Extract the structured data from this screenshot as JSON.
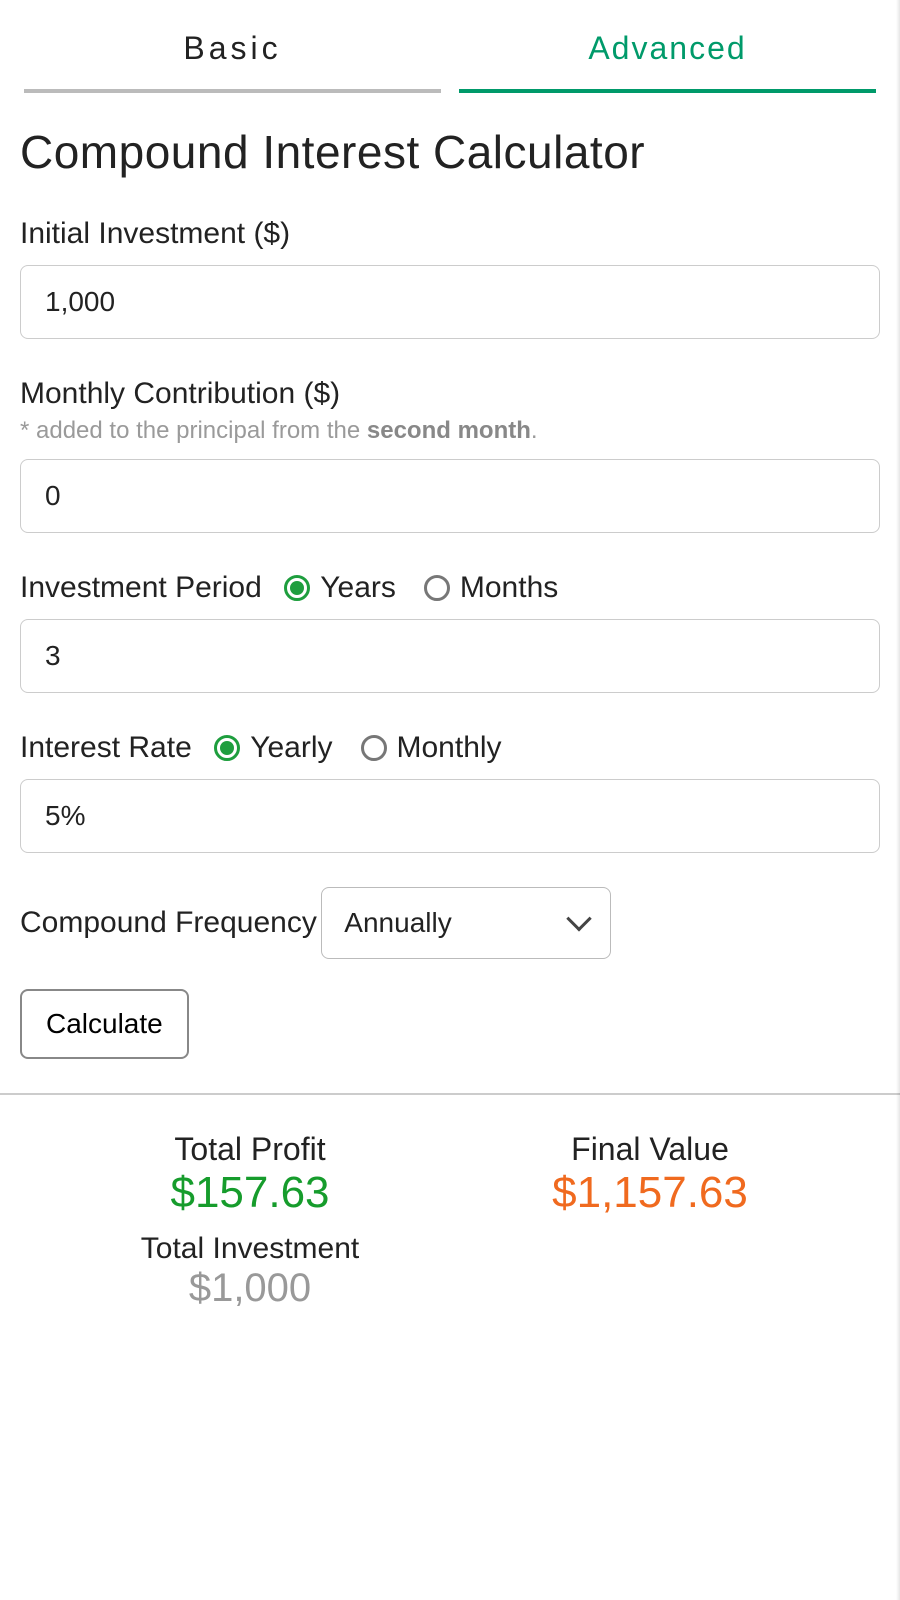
{
  "tabs": {
    "basic": "Basic",
    "advanced": "Advanced",
    "active": "advanced"
  },
  "title": "Compound Interest Calculator",
  "colors": {
    "accent": "#009a6a",
    "profit": "#169c2c",
    "final": "#f06a1f",
    "muted": "#999"
  },
  "fields": {
    "initial": {
      "label": "Initial Investment ($)",
      "value": "1,000"
    },
    "monthly": {
      "label": "Monthly Contribution ($)",
      "hint_prefix": "* added to the principal from the ",
      "hint_strong": "second month",
      "hint_suffix": ".",
      "value": "0"
    },
    "period": {
      "label": "Investment Period",
      "options": {
        "years": "Years",
        "months": "Months"
      },
      "selected": "years",
      "value": "3"
    },
    "rate": {
      "label": "Interest Rate",
      "options": {
        "yearly": "Yearly",
        "monthly": "Monthly"
      },
      "selected": "yearly",
      "value": "5%"
    },
    "frequency": {
      "label": "Compound Frequency",
      "selected": "Annually"
    }
  },
  "calculate_label": "Calculate",
  "results": {
    "profit": {
      "label": "Total Profit",
      "value": "$157.63"
    },
    "final": {
      "label": "Final Value",
      "value": "$1,157.63"
    },
    "invested": {
      "label": "Total Investment",
      "value": "$1,000"
    }
  }
}
